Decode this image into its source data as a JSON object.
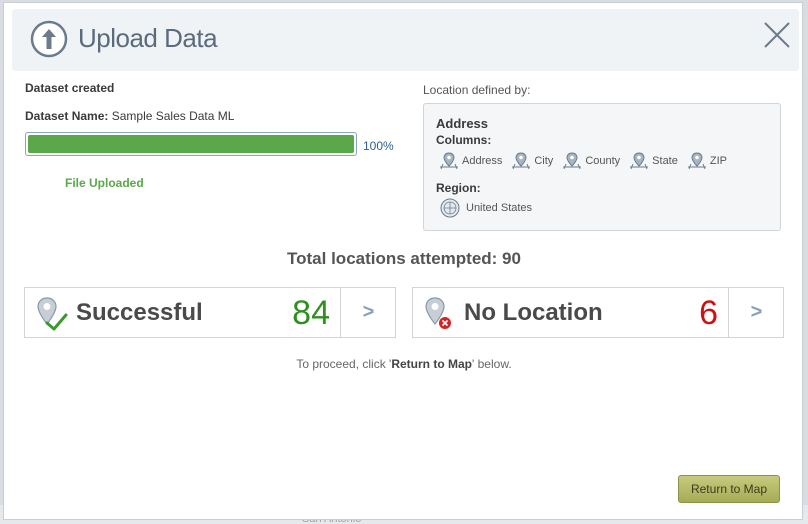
{
  "background": {
    "map_text": "San Antonio"
  },
  "header": {
    "title": "Upload Data",
    "up_icon": "upload-arrow-icon",
    "close_icon": "close-x-icon"
  },
  "upload": {
    "status_title": "Dataset created",
    "dataset_name_label": "Dataset Name:",
    "dataset_name": "Sample Sales Data ML",
    "progress": 100,
    "progress_text": "100%",
    "file_status": "File Uploaded"
  },
  "location": {
    "label": "Location defined by:",
    "type": "Address",
    "columns_label": "Columns:",
    "columns": [
      "Address",
      "City",
      "County",
      "State",
      "ZIP"
    ],
    "region_label": "Region:",
    "region": "United States"
  },
  "summary": {
    "total_text": "Total locations attempted: 90"
  },
  "results": {
    "successful": {
      "label": "Successful",
      "count": "84",
      "arrow": ">"
    },
    "no_location": {
      "label": "No Location",
      "count": "6",
      "arrow": ">"
    }
  },
  "footer": {
    "proceed_pre": "To proceed, click '",
    "proceed_strong": "Return to Map",
    "proceed_post": "' below.",
    "return_button": "Return to Map"
  },
  "colors": {
    "success": "#2f8f1f",
    "error": "#d01010",
    "progress": "#5aa84a",
    "button": "#b5bb66"
  }
}
